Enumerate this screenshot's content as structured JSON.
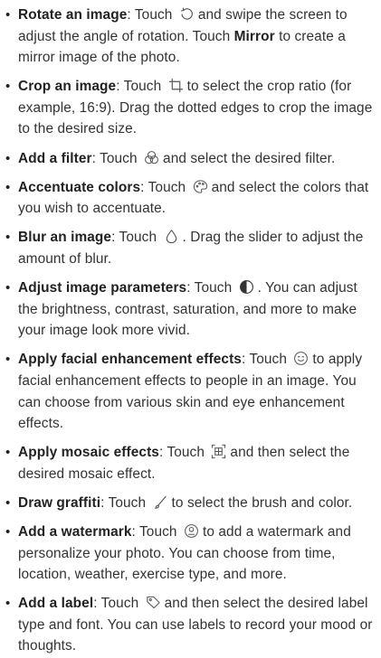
{
  "items": [
    {
      "lead": "Rotate an image",
      "pre": ": Touch",
      "icon": "rotate-icon",
      "mid": "and swipe the screen to adjust the angle of rotation. Touch ",
      "emph": "Mirror",
      "post": " to create a mirror image of the photo."
    },
    {
      "lead": "Crop an image",
      "pre": ": Touch",
      "icon": "crop-icon",
      "post": "to select the crop ratio (for example, 16:9). Drag the dotted edges to crop the image to the desired size."
    },
    {
      "lead": "Add a filter",
      "pre": ": Touch",
      "icon": "filter-icon",
      "post": "and select the desired filter."
    },
    {
      "lead": "Accentuate colors",
      "pre": ": Touch",
      "icon": "accentuate-colors-icon",
      "post": "and select the colors that you wish to accentuate."
    },
    {
      "lead": "Blur an image",
      "pre": ": Touch",
      "icon": "blur-icon",
      "post": ". Drag the slider to adjust the amount of blur."
    },
    {
      "lead": "Adjust image parameters",
      "pre": ": Touch",
      "icon": "adjust-icon",
      "post": ". You can adjust the brightness, contrast, saturation, and more to make your image look more vivid."
    },
    {
      "lead": "Apply facial enhancement effects",
      "pre": ": Touch",
      "icon": "face-icon",
      "post": "to apply facial enhancement effects to people in an image. You can choose from various skin and eye enhancement effects."
    },
    {
      "lead": "Apply mosaic effects",
      "pre": ": Touch",
      "icon": "mosaic-icon",
      "post": "and then select the desired mosaic effect."
    },
    {
      "lead": "Draw graffiti",
      "pre": ": Touch",
      "icon": "brush-icon",
      "post": "to select the brush and color."
    },
    {
      "lead": "Add a watermark",
      "pre": ": Touch",
      "icon": "watermark-icon",
      "post": "to add a watermark and personalize your photo. You can choose from time, location, weather, exercise type, and more."
    },
    {
      "lead": "Add a label",
      "pre": ": Touch",
      "icon": "label-icon",
      "post": "and then select the desired label type and font. You can use labels to record your mood or thoughts."
    }
  ]
}
